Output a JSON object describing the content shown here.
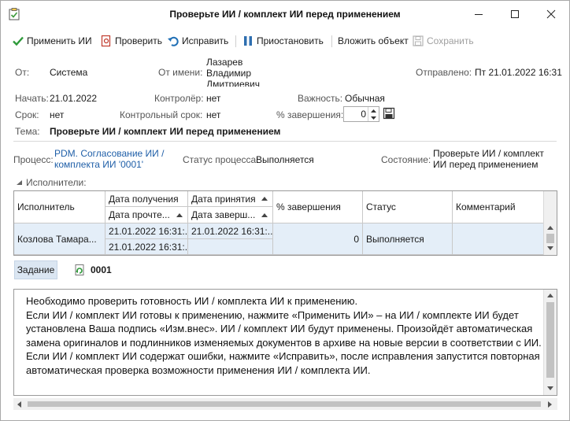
{
  "window": {
    "title": "Проверьте ИИ / комплект ИИ перед применением"
  },
  "toolbar": {
    "apply": "Применить ИИ",
    "check": "Проверить",
    "fix": "Исправить",
    "pause": "Приостановить",
    "attach": "Вложить объект",
    "save": "Сохранить"
  },
  "form": {
    "from_label": "От:",
    "from_value": "Система",
    "on_behalf_label": "От имени:",
    "on_behalf_value": "Лазарев Владимир Дмитриевич",
    "sent_label": "Отправлено:",
    "sent_value": "Пт 21.01.2022 16:31",
    "start_label": "Начать:",
    "start_value": "21.01.2022",
    "controller_label": "Контролёр:",
    "controller_value": "нет",
    "importance_label": "Важность:",
    "importance_value": "Обычная",
    "due_label": "Срок:",
    "due_value": "нет",
    "control_due_label": "Контрольный срок:",
    "control_due_value": "нет",
    "completion_label": "% завершения:",
    "completion_value": "0",
    "subject_label": "Тема:",
    "subject_value": "Проверьте ИИ / комплект ИИ перед применением"
  },
  "process": {
    "process_label": "Процесс:",
    "process_value": "PDM. Согласование ИИ / комплекта ИИ '0001'",
    "status_label": "Статус процесса:",
    "status_value": "Выполняется",
    "state_label": "Состояние:",
    "state_value": "Проверьте ИИ / комплект ИИ перед применением"
  },
  "executors": {
    "section_title": "Исполнители:",
    "headers": {
      "executor": "Исполнитель",
      "received": "Дата получения",
      "read": "Дата прочте...",
      "accepted": "Дата принятия",
      "completed": "Дата заверш...",
      "percent": "% завершения",
      "status": "Статус",
      "comment": "Комментарий"
    },
    "rows": [
      {
        "executor": "Козлова Тамара...",
        "received": "21.01.2022 16:31:...",
        "read": "21.01.2022 16:31:...",
        "accepted": "21.01.2022 16:31:...",
        "completed": "",
        "percent": "0",
        "status": "Выполняется",
        "comment": ""
      }
    ]
  },
  "task": {
    "tab_label": "Задание",
    "number": "0001",
    "text": "Необходимо проверить готовность ИИ / комплекта ИИ к применению.\nЕсли ИИ / комплект ИИ готовы к применению, нажмите «Применить ИИ» – на ИИ / комплекте ИИ будет установлена Ваша подпись «Изм.внес». ИИ / комплект ИИ будут применены. Произойдёт автоматическая замена оригиналов и подлинников изменяемых документов в архиве на новые версии в соответствии с ИИ.\nЕсли ИИ / комплект ИИ содержат ошибки, нажмите «Исправить», после исправления запустится повторная автоматическая проверка возможности применения ИИ / комплекта ИИ."
  }
}
